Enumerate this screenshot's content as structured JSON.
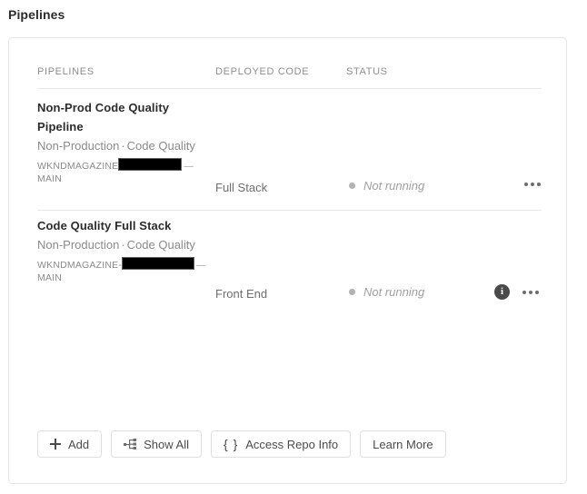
{
  "page": {
    "title": "Pipelines",
    "background": "#ffffff",
    "card_border_color": "#e6e6e6"
  },
  "table": {
    "columns": [
      {
        "key": "pipelines",
        "label": "PIPELINES"
      },
      {
        "key": "deployed_code",
        "label": "DEPLOYED CODE"
      },
      {
        "key": "status",
        "label": "STATUS"
      }
    ],
    "rows": [
      {
        "name": "Non-Prod Code Quality Pipeline",
        "environment": "Non-Production",
        "separator": "·",
        "kind": "Code Quality",
        "repo_prefix": "WKNDMAGAZINE",
        "repo_redacted": true,
        "repo_suffix_dash": "—",
        "branch": "MAIN",
        "deployed_code": "Full Stack",
        "status": "Not running",
        "status_dot_color": "#b3b3b3",
        "has_info_icon": false,
        "more_label": "More actions"
      },
      {
        "name": "Code Quality Full Stack",
        "environment": "Non-Production",
        "separator": "·",
        "kind": "Code Quality",
        "repo_prefix": "WKNDMAGAZINE-",
        "repo_redacted": true,
        "repo_suffix_dash": "—",
        "branch": "MAIN",
        "deployed_code": "Front End",
        "status": "Not running",
        "status_dot_color": "#b3b3b3",
        "has_info_icon": true,
        "info_label": "i",
        "more_label": "More actions"
      }
    ]
  },
  "footer": {
    "buttons": [
      {
        "id": "add",
        "label": "Add",
        "icon": "plus-icon"
      },
      {
        "id": "show-all",
        "label": "Show All",
        "icon": "tree-hierarchy-icon"
      },
      {
        "id": "access-repo-info",
        "label": "Access Repo Info",
        "icon": "curly-braces-icon",
        "icon_glyph": "{ }"
      },
      {
        "id": "learn-more",
        "label": "Learn More",
        "icon": null
      }
    ]
  }
}
